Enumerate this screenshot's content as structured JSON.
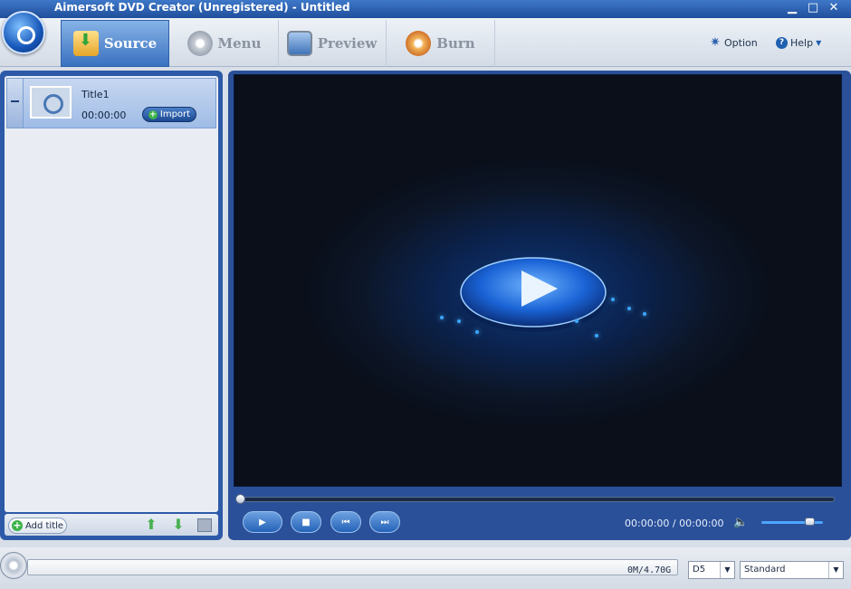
{
  "app": {
    "title": "Aimersoft DVD Creator (Unregistered) - Untitled",
    "window_controls": [
      "minimize-icon",
      "maximize-icon",
      "close-icon"
    ]
  },
  "toolbar": {
    "tabs": [
      {
        "label": "Source",
        "icon": "source-import-icon",
        "active": true
      },
      {
        "label": "Menu",
        "icon": "menu-disc-icon",
        "active": false
      },
      {
        "label": "Preview",
        "icon": "preview-monitor-icon",
        "active": false
      },
      {
        "label": "Burn",
        "icon": "burn-disc-icon",
        "active": false
      }
    ],
    "option_label": "Option",
    "help_label": "Help"
  },
  "titles": {
    "items": [
      {
        "name": "Title1",
        "duration": "00:00:00",
        "import_label": "Import"
      }
    ],
    "add_title_label": "Add title"
  },
  "player": {
    "time_current": "00:00:00",
    "time_total": "00:00:00",
    "time_separator": "/",
    "volume_level": 0.75,
    "seek_position": 0
  },
  "status": {
    "capacity": "0M/4.70G",
    "disc_type": "D5",
    "quality": "Standard"
  },
  "colors": {
    "accent": "#2d5aa8",
    "titlebar": "#1f4f9c",
    "active_tab": "#3a72c0",
    "add_green": "#3db34a"
  }
}
